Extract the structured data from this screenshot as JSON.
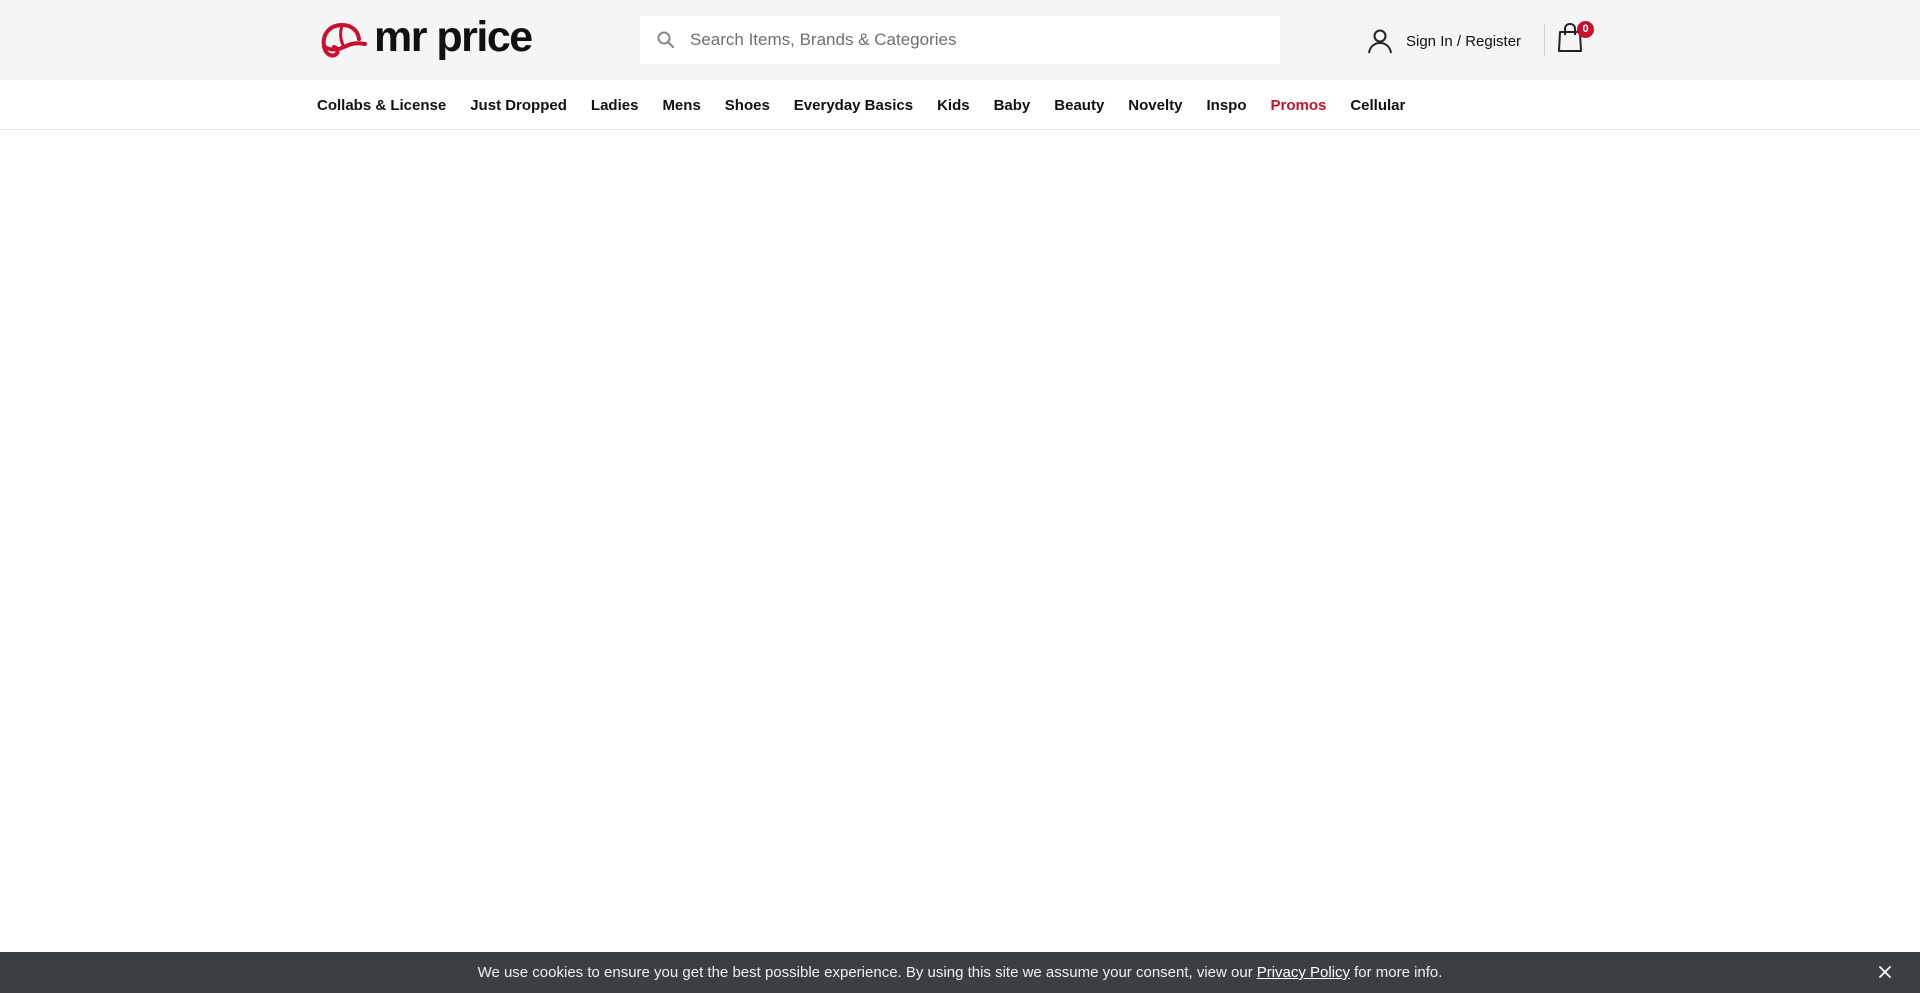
{
  "header": {
    "logo_text": "mr price",
    "logo_icon": "cap-icon",
    "brand_color": "#c8102e",
    "search": {
      "placeholder": "Search Items, Brands & Categories",
      "value": ""
    },
    "account_label": "Sign In / Register",
    "cart_count": "0"
  },
  "nav": {
    "items": [
      {
        "label": "Collabs & License"
      },
      {
        "label": "Just Dropped"
      },
      {
        "label": "Ladies"
      },
      {
        "label": "Mens"
      },
      {
        "label": "Shoes"
      },
      {
        "label": "Everyday Basics"
      },
      {
        "label": "Kids"
      },
      {
        "label": "Baby"
      },
      {
        "label": "Beauty"
      },
      {
        "label": "Novelty"
      },
      {
        "label": "Inspo"
      },
      {
        "label": "Promos"
      },
      {
        "label": "Cellular"
      }
    ]
  },
  "cookie_banner": {
    "text_before": "We use cookies to ensure you get the best possible experience. By using this site we assume your consent, view our",
    "link_label": "Privacy Policy",
    "text_after": "for more info."
  }
}
